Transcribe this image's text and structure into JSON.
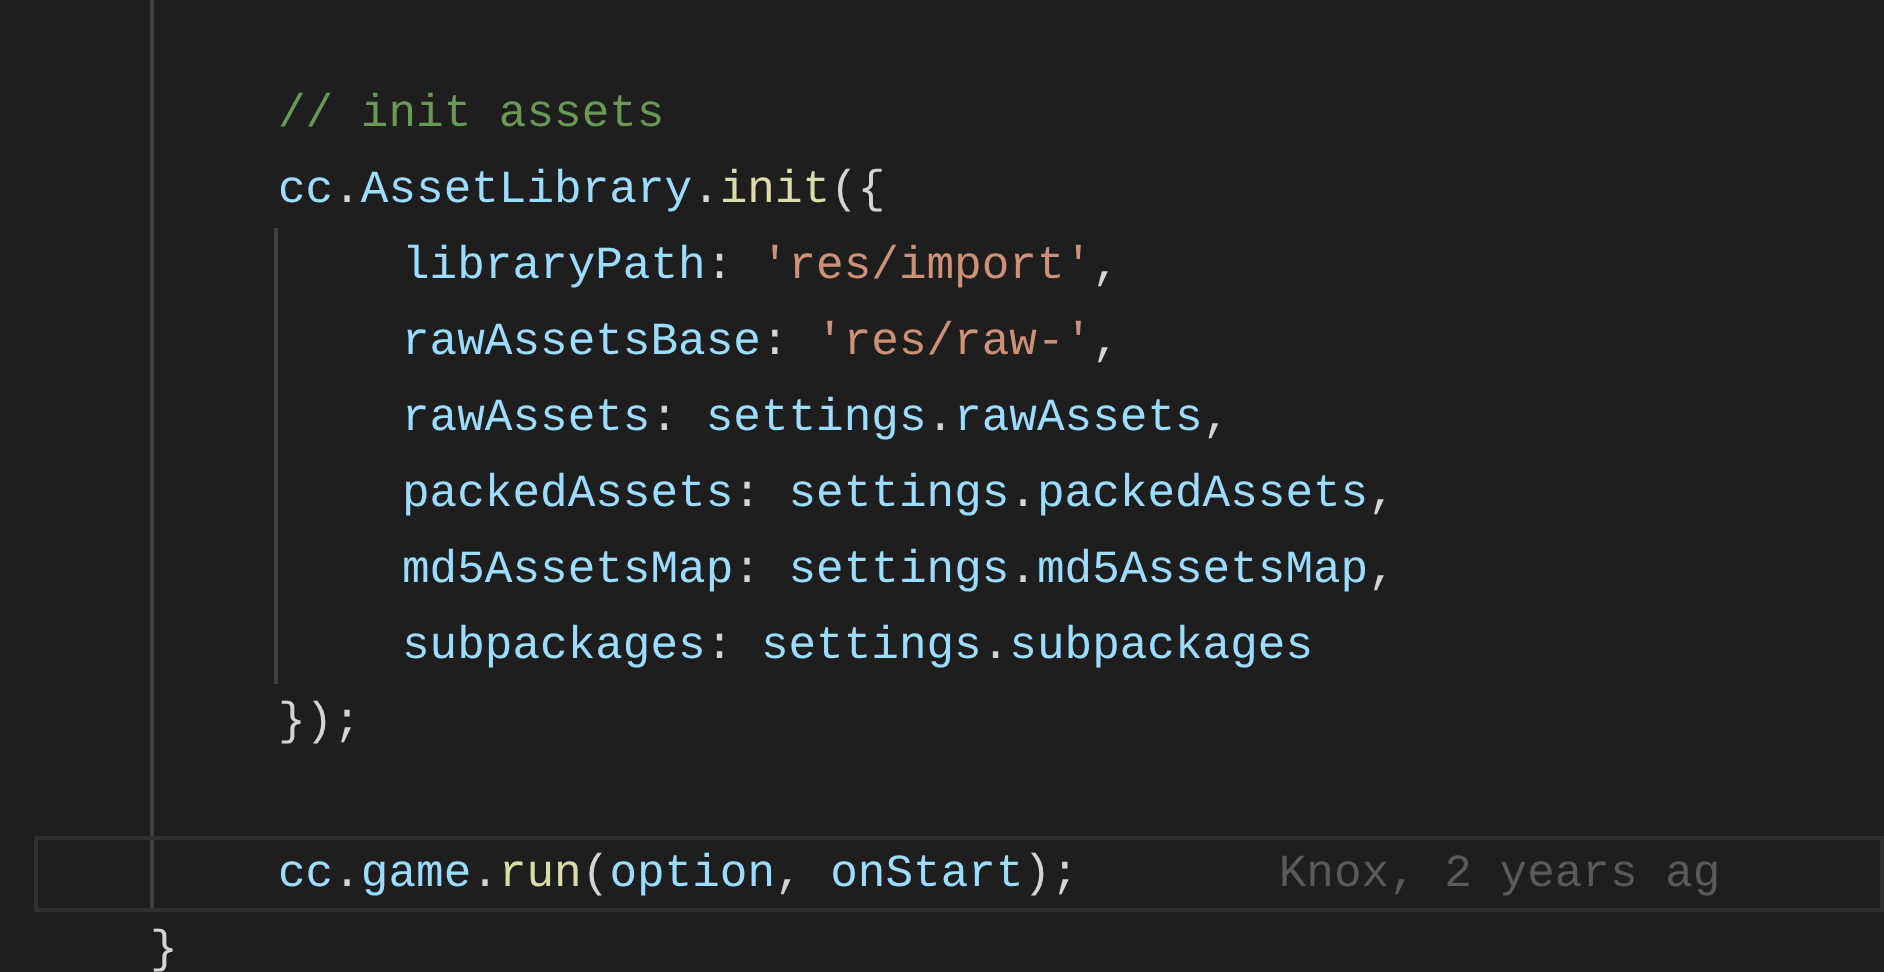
{
  "editor": {
    "block": [
      {
        "kind": "blank",
        "current": false
      },
      {
        "kind": "code",
        "current": false,
        "tokens": [
          {
            "kind": "comment",
            "text": "// init assets"
          }
        ]
      },
      {
        "kind": "code",
        "current": false,
        "tokens": [
          {
            "kind": "variable",
            "text": "cc"
          },
          {
            "kind": "plain",
            "text": "."
          },
          {
            "kind": "variable",
            "text": "AssetLibrary"
          },
          {
            "kind": "plain",
            "text": "."
          },
          {
            "kind": "function",
            "text": "init"
          },
          {
            "kind": "plain",
            "text": "({"
          }
        ],
        "children": [
          {
            "kind": "code",
            "current": false,
            "tokens": [
              {
                "kind": "variable",
                "text": "libraryPath"
              },
              {
                "kind": "plain",
                "text": ": "
              },
              {
                "kind": "string",
                "text": "'res/import'"
              },
              {
                "kind": "plain",
                "text": ","
              }
            ]
          },
          {
            "kind": "code",
            "current": false,
            "tokens": [
              {
                "kind": "variable",
                "text": "rawAssetsBase"
              },
              {
                "kind": "plain",
                "text": ": "
              },
              {
                "kind": "string",
                "text": "'res/raw-'"
              },
              {
                "kind": "plain",
                "text": ","
              }
            ]
          },
          {
            "kind": "code",
            "current": false,
            "tokens": [
              {
                "kind": "variable",
                "text": "rawAssets"
              },
              {
                "kind": "plain",
                "text": ": "
              },
              {
                "kind": "variable",
                "text": "settings"
              },
              {
                "kind": "plain",
                "text": "."
              },
              {
                "kind": "variable",
                "text": "rawAssets"
              },
              {
                "kind": "plain",
                "text": ","
              }
            ]
          },
          {
            "kind": "code",
            "current": false,
            "tokens": [
              {
                "kind": "variable",
                "text": "packedAssets"
              },
              {
                "kind": "plain",
                "text": ": "
              },
              {
                "kind": "variable",
                "text": "settings"
              },
              {
                "kind": "plain",
                "text": "."
              },
              {
                "kind": "variable",
                "text": "packedAssets"
              },
              {
                "kind": "plain",
                "text": ","
              }
            ]
          },
          {
            "kind": "code",
            "current": false,
            "tokens": [
              {
                "kind": "variable",
                "text": "md5AssetsMap"
              },
              {
                "kind": "plain",
                "text": ": "
              },
              {
                "kind": "variable",
                "text": "settings"
              },
              {
                "kind": "plain",
                "text": "."
              },
              {
                "kind": "variable",
                "text": "md5AssetsMap"
              },
              {
                "kind": "plain",
                "text": ","
              }
            ]
          },
          {
            "kind": "code",
            "current": false,
            "tokens": [
              {
                "kind": "variable",
                "text": "subpackages"
              },
              {
                "kind": "plain",
                "text": ": "
              },
              {
                "kind": "variable",
                "text": "settings"
              },
              {
                "kind": "plain",
                "text": "."
              },
              {
                "kind": "variable",
                "text": "subpackages"
              }
            ]
          }
        ]
      },
      {
        "kind": "code",
        "current": false,
        "tokens": [
          {
            "kind": "plain",
            "text": "});"
          }
        ]
      },
      {
        "kind": "blank",
        "current": false
      },
      {
        "kind": "code",
        "current": true,
        "blame": "Knox, 2 years ag",
        "tokens": [
          {
            "kind": "variable",
            "text": "cc"
          },
          {
            "kind": "plain",
            "text": "."
          },
          {
            "kind": "variable",
            "text": "game"
          },
          {
            "kind": "plain",
            "text": "."
          },
          {
            "kind": "function",
            "text": "run"
          },
          {
            "kind": "plain",
            "text": "("
          },
          {
            "kind": "variable",
            "text": "option"
          },
          {
            "kind": "plain",
            "text": ", "
          },
          {
            "kind": "variable",
            "text": "onStart"
          },
          {
            "kind": "plain",
            "text": ");"
          }
        ]
      }
    ],
    "closing": {
      "tokens": [
        {
          "kind": "plain",
          "text": "}"
        }
      ]
    }
  }
}
